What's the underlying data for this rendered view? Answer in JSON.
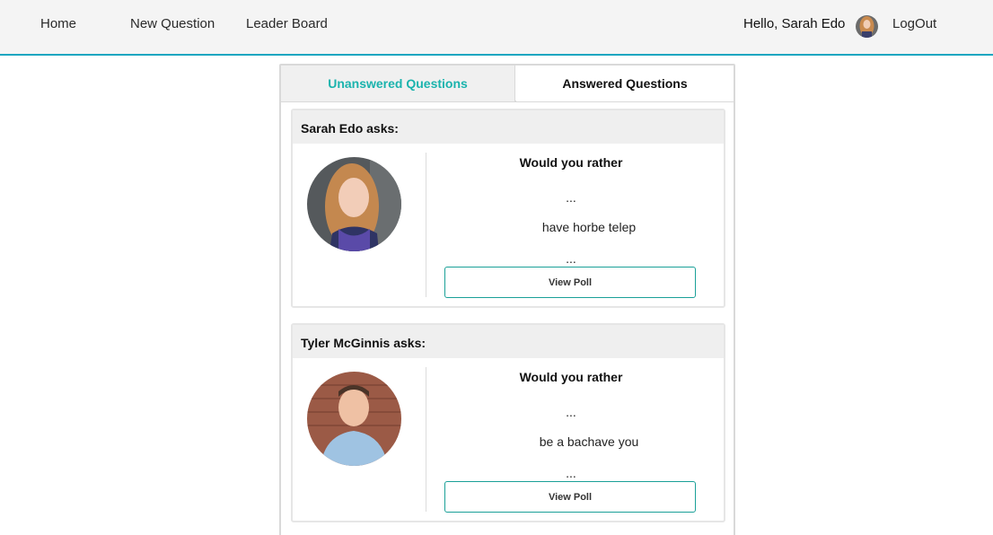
{
  "nav": {
    "home": "Home",
    "new_question": "New Question",
    "leader_board": "Leader Board",
    "greeting": "Hello, Sarah Edo",
    "logout": "LogOut",
    "accent_color": "#1aa6c0"
  },
  "tabs": {
    "unanswered": "Unanswered Questions",
    "answered": "Answered Questions",
    "active_color": "#1ab3ad"
  },
  "questions": [
    {
      "header": "Sarah Edo asks:",
      "title": "Would you rather",
      "dots_top": "...",
      "preview": "have horbe telep",
      "dots_bottom": "...",
      "button": "View Poll"
    },
    {
      "header": "Tyler McGinnis asks:",
      "title": "Would you rather",
      "dots_top": "...",
      "preview": "be a bachave you",
      "dots_bottom": "...",
      "button": "View Poll"
    }
  ]
}
